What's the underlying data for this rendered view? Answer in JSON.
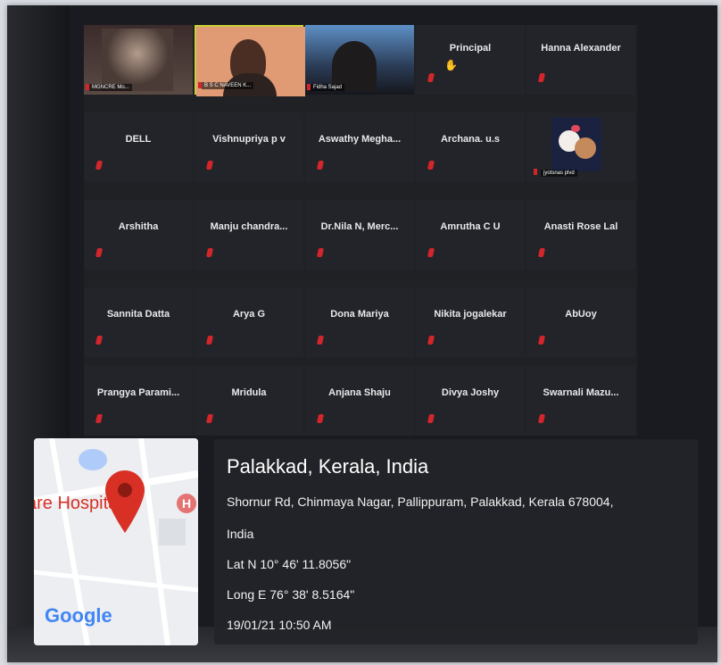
{
  "participants_row1": [
    {
      "label": "MGNCRE Mo...",
      "kind": "video"
    },
    {
      "label": "B S C NAVEEN K...",
      "kind": "video"
    },
    {
      "label": "Fidha Sajad",
      "kind": "video"
    },
    {
      "label": "Principal",
      "kind": "name"
    },
    {
      "label": "Hanna Alexander",
      "kind": "name"
    }
  ],
  "participants_row2": [
    "DELL",
    "Vishnupriya p v",
    "Aswathy  Megha...",
    "Archana. u.s",
    "jyotsnas plvd"
  ],
  "participants_row3": [
    "Arshitha",
    "Manju chandra...",
    "Dr.Nila N, Merc...",
    "Amrutha C U",
    "Anasti Rose Lal"
  ],
  "participants_row4": [
    "Sannita Datta",
    "Arya G",
    "Dona Mariya",
    "Nikita jogalekar",
    "AbUoy"
  ],
  "participants_row5": [
    "Prangya  Parami...",
    "Mridula",
    "Anjana Shaju",
    "Divya Joshy",
    "Swarnali  Mazu..."
  ],
  "location": {
    "city": "Palakkad, Kerala, India",
    "address_line1": "Shornur Rd, Chinmaya Nagar, Pallippuram, Palakkad, Kerala 678004,",
    "address_line2": "India",
    "lat": "Lat N 10° 46' 11.8056\"",
    "long": "Long E 76° 38' 8.5164\"",
    "datetime": "19/01/21 10:50 AM"
  },
  "map": {
    "poi_text": "care Hospital",
    "poi_glyph": "H",
    "brand": "Google"
  },
  "colors": {
    "mic_muted": "#d2262b",
    "active_speaker": "#c8d236",
    "map_pin": "#d93025"
  }
}
